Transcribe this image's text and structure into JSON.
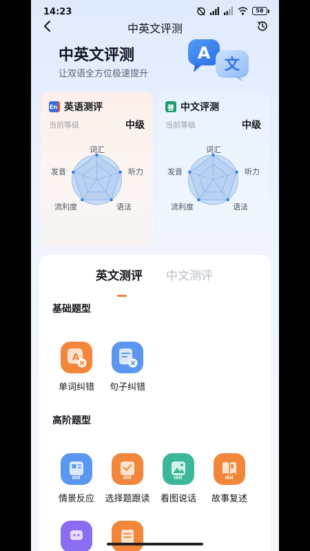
{
  "status_bar": {
    "time": "14:23",
    "battery": "58"
  },
  "nav": {
    "title": "中英文评测"
  },
  "hero": {
    "title": "中英文评测",
    "subtitle": "让双语全方位极速提升",
    "art_letters": [
      "A",
      "文"
    ]
  },
  "cards": {
    "english": {
      "badge": "En",
      "title": "英语测评",
      "level_label": "当前等级",
      "level": "中级",
      "axes": [
        "词汇",
        "听力",
        "语法",
        "流利度",
        "发音"
      ]
    },
    "chinese": {
      "badge": "普",
      "title": "中文评测",
      "level_label": "当前等级",
      "level": "中级",
      "axes": [
        "词汇",
        "听力",
        "语法",
        "流利度",
        "发音"
      ]
    }
  },
  "tabs": [
    {
      "label": "英文测评",
      "active": true
    },
    {
      "label": "中文测评",
      "active": false
    }
  ],
  "sections": {
    "basic": {
      "title": "基础题型",
      "items": [
        {
          "label": "单词纠错",
          "icon": "word-correction-icon"
        },
        {
          "label": "句子纠错",
          "icon": "sentence-correction-icon"
        }
      ]
    },
    "advanced": {
      "title": "高阶题型",
      "items": [
        {
          "label": "情景反应",
          "icon": "scenario-response-icon"
        },
        {
          "label": "选择题跟读",
          "icon": "choice-read-icon"
        },
        {
          "label": "看图说话",
          "icon": "picture-talk-icon"
        },
        {
          "label": "故事复述",
          "icon": "story-retell-icon"
        }
      ]
    }
  },
  "colors": {
    "accent": "#f0822f",
    "blue": "#4d8bf0",
    "green": "#3bb89a"
  }
}
